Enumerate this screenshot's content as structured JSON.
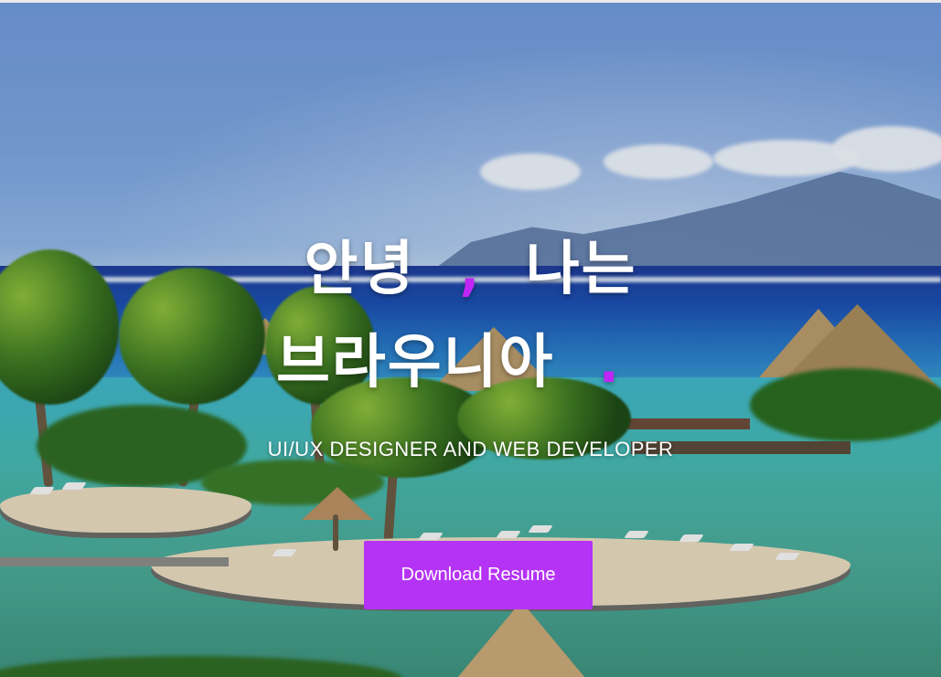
{
  "hero": {
    "headline_line1_part1": "안녕",
    "headline_line1_separator": ",",
    "headline_line1_part2": "나는",
    "headline_line2_name": "브라우니아",
    "headline_line2_period": ".",
    "subtitle": "UI/UX DESIGNER AND WEB DEVELOPER",
    "cta_label": "Download Resume"
  },
  "colors": {
    "accent": "#c026f5",
    "button": "#b533f5",
    "text": "#ffffff"
  },
  "background_description_icon": "tropical-resort-background"
}
